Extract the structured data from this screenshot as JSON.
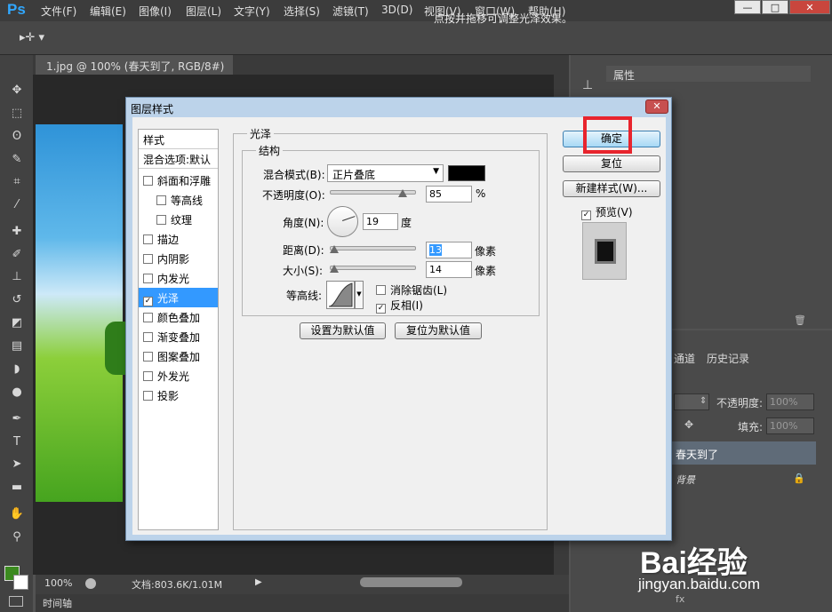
{
  "app": {
    "logo": "Ps"
  },
  "menu": [
    "文件(F)",
    "编辑(E)",
    "图像(I)",
    "图层(L)",
    "文字(Y)",
    "选择(S)",
    "滤镜(T)",
    "3D(D)",
    "视图(V)",
    "窗口(W)",
    "帮助(H)"
  ],
  "window_controls": {
    "minimize": "—",
    "restore": "□",
    "close": "✕"
  },
  "options_bar": {
    "hint": "点按并拖移可调整光泽效果。"
  },
  "document": {
    "tab": "1.jpg @ 100% (春天到了, RGB/8#) *",
    "tab_close": "×"
  },
  "status": {
    "zoom": "100%",
    "doc_size": "文档:803.6K/1.01M",
    "timeline": "时间轴"
  },
  "panels": {
    "properties_tab": "属性",
    "layers_tabs": [
      "通道",
      "历史记录"
    ],
    "opacity_label": "不透明度:",
    "opacity_value": "100%",
    "fill_label": "填充:",
    "fill_value": "100%",
    "layers": [
      "春天到了",
      "背景"
    ]
  },
  "dialog": {
    "title": "图层样式",
    "close": "✕",
    "style_list": [
      {
        "label": "样式",
        "type": "header"
      },
      {
        "label": "混合选项:默认",
        "type": "header"
      },
      {
        "label": "斜面和浮雕",
        "checked": false,
        "indent": 0
      },
      {
        "label": "等高线",
        "checked": false,
        "indent": 1
      },
      {
        "label": "纹理",
        "checked": false,
        "indent": 1
      },
      {
        "label": "描边",
        "checked": false,
        "indent": 0
      },
      {
        "label": "内阴影",
        "checked": false,
        "indent": 0
      },
      {
        "label": "内发光",
        "checked": false,
        "indent": 0
      },
      {
        "label": "光泽",
        "checked": true,
        "indent": 0,
        "selected": true
      },
      {
        "label": "颜色叠加",
        "checked": false,
        "indent": 0
      },
      {
        "label": "渐变叠加",
        "checked": false,
        "indent": 0
      },
      {
        "label": "图案叠加",
        "checked": false,
        "indent": 0
      },
      {
        "label": "外发光",
        "checked": false,
        "indent": 0
      },
      {
        "label": "投影",
        "checked": false,
        "indent": 0
      }
    ],
    "group_title": "光泽",
    "structure_title": "结构",
    "blend_mode_label": "混合模式(B):",
    "blend_mode_value": "正片叠底",
    "blend_color": "#000000",
    "opacity_label": "不透明度(O):",
    "opacity_value": "85",
    "opacity_unit": "%",
    "opacity_fraction": 0.85,
    "angle_label": "角度(N):",
    "angle_value": "19",
    "angle_unit": "度",
    "distance_label": "距离(D):",
    "distance_value": "13",
    "distance_unit": "像素",
    "distance_fraction": 0.05,
    "size_label": "大小(S):",
    "size_value": "14",
    "size_unit": "像素",
    "size_fraction": 0.05,
    "contour_label": "等高线:",
    "antialias_label": "消除锯齿(L)",
    "antialias_checked": false,
    "invert_label": "反相(I)",
    "invert_checked": true,
    "set_default": "设置为默认值",
    "reset_default": "复位为默认值",
    "ok": "确定",
    "reset": "复位",
    "new_style": "新建样式(W)...",
    "preview_label": "预览(V)",
    "preview_checked": true
  },
  "watermark": {
    "logo": "Bai经验",
    "url": "jingyan.baidu.com"
  }
}
